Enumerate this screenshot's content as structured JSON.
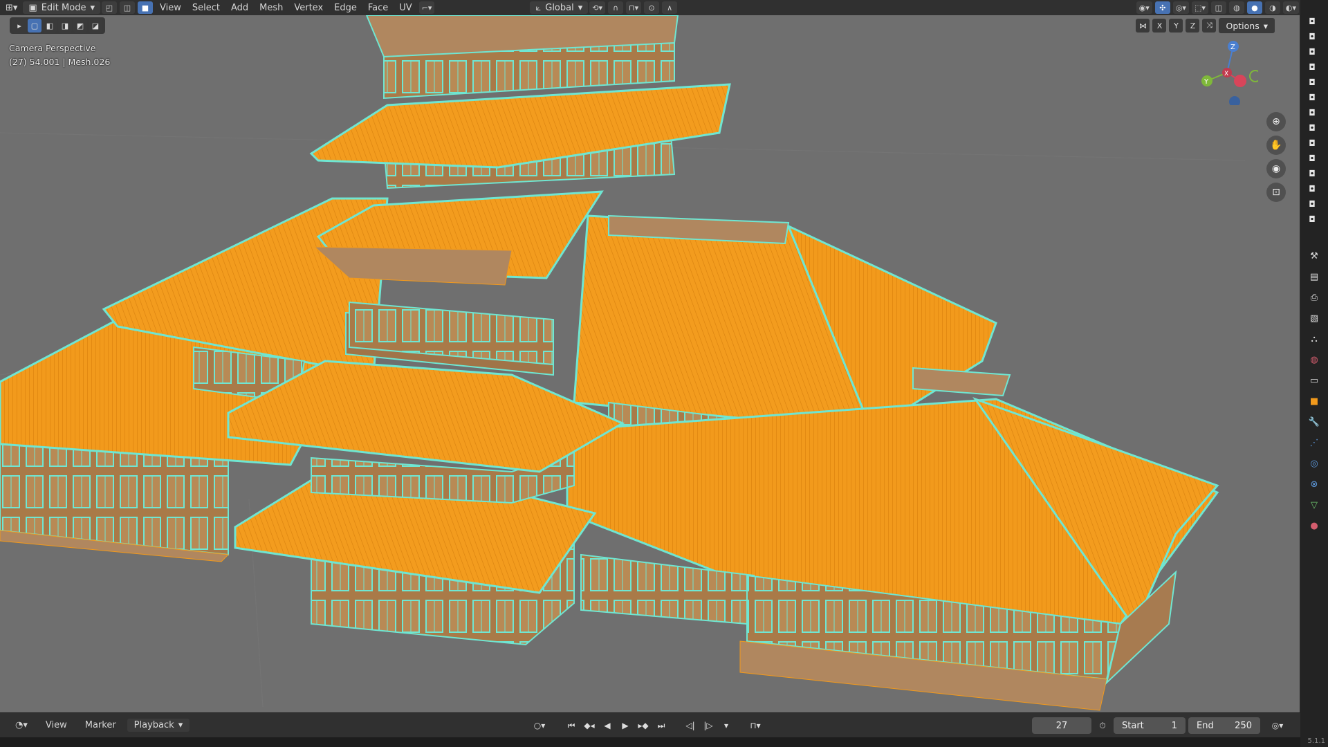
{
  "topbar": {
    "mode": "Edit Mode",
    "menus": [
      "View",
      "Select",
      "Add",
      "Mesh",
      "Vertex",
      "Edge",
      "Face",
      "UV"
    ],
    "transform_orientation": "Global"
  },
  "viewport": {
    "view_name": "Camera Perspective",
    "object_info": "(27) 54.001 | Mesh.026",
    "axis_labels": {
      "x": "X",
      "y": "Y",
      "z": "Z"
    },
    "mirror_axes": [
      "X",
      "Y",
      "Z"
    ],
    "options_label": "Options"
  },
  "timeline": {
    "menus": [
      "View",
      "Marker"
    ],
    "playback_label": "Playback",
    "current_frame": "27",
    "start_label": "Start",
    "start_value": "1",
    "end_label": "End",
    "end_value": "250"
  },
  "status": {
    "version": "5.1.1"
  },
  "colors": {
    "roof_orange": "#f29a1c",
    "wall_tan": "#b0875f",
    "edge_cyan": "#6fe6d2",
    "viewport_bg": "#6f6f6f",
    "accent_blue": "#4772b3"
  }
}
